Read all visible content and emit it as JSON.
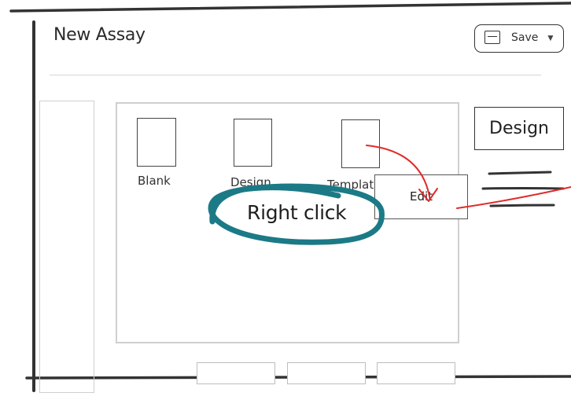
{
  "app": {
    "title": "New Assay"
  },
  "toolbar": {
    "save_label": "Save",
    "save_icon": "save-icon",
    "caret_icon": "chevron-down-icon",
    "caret_glyph": "▼"
  },
  "templates": [
    {
      "label": "Blank"
    },
    {
      "label": "Design"
    },
    {
      "label": "Template"
    }
  ],
  "context_menu": {
    "items": [
      {
        "label": "Edit"
      }
    ]
  },
  "side_panel": {
    "design_label": "Design",
    "menu_icon": "hamburger-menu-icon"
  },
  "annotations": {
    "right_click": "Right click",
    "colors": {
      "arrow": "#e02a2a",
      "highlight": "#1b7a86",
      "frame": "#333333"
    }
  }
}
